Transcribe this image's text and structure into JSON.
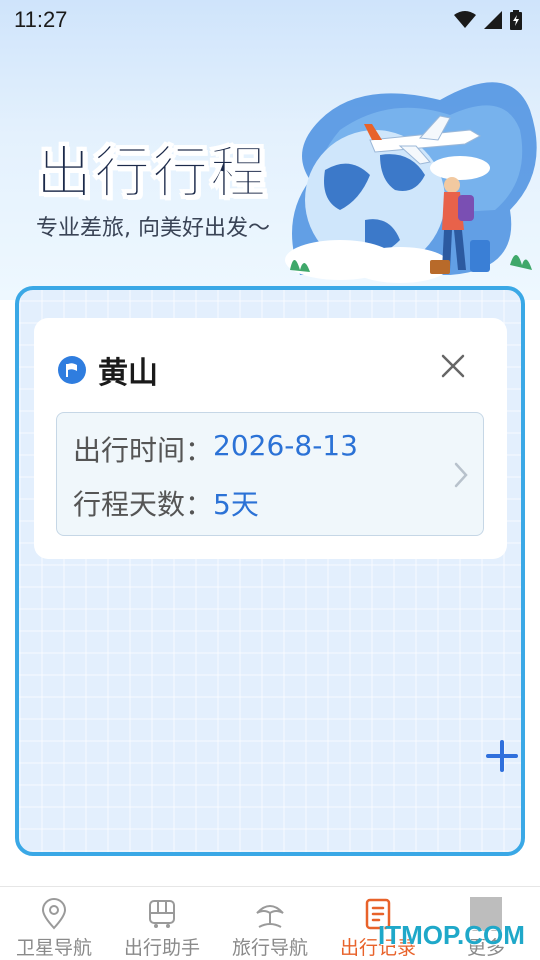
{
  "status_bar": {
    "time": "11:27"
  },
  "hero": {
    "title": "出行行程",
    "subtitle": "专业差旅, 向美好出发～"
  },
  "trip": {
    "destination": "黄山",
    "depart_label": "出行时间：",
    "depart_value": "2026-8-13",
    "days_label": "行程天数：",
    "days_value": "5天"
  },
  "nav": {
    "items": [
      {
        "label": "卫星导航",
        "icon": "location-pin-icon"
      },
      {
        "label": "出行助手",
        "icon": "bus-icon"
      },
      {
        "label": "旅行导航",
        "icon": "beach-umbrella-icon"
      },
      {
        "label": "出行记录",
        "icon": "record-icon",
        "active": true
      },
      {
        "label": "更多",
        "icon": "more-icon"
      }
    ]
  },
  "watermark": "ITMOP.COM",
  "colors": {
    "accent": "#2b72d6",
    "frame": "#3aa8e6",
    "active_nav": "#e8622a"
  }
}
